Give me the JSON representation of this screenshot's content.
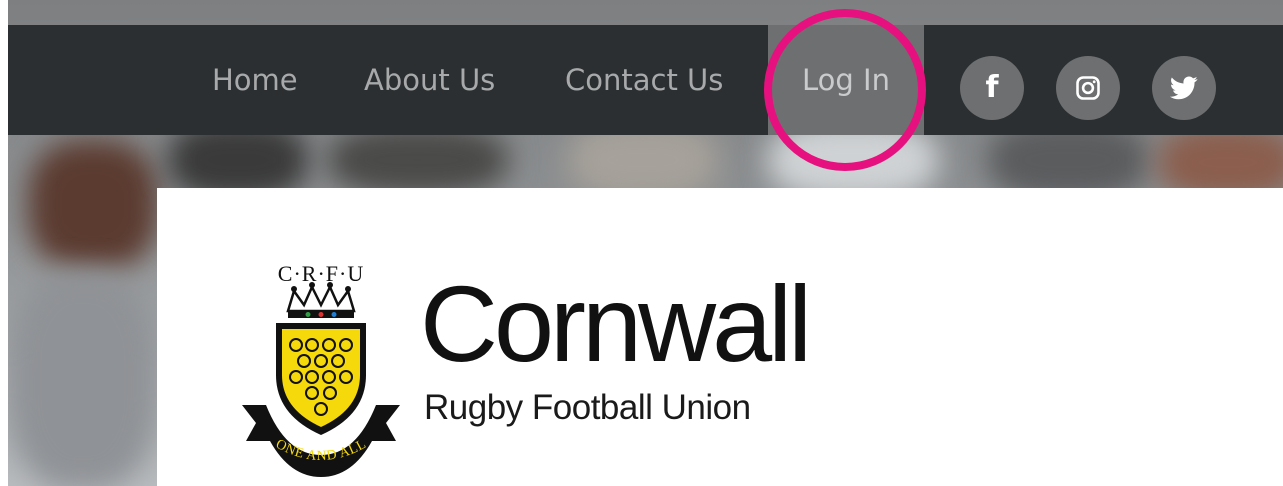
{
  "nav": {
    "items": [
      {
        "label": "Home"
      },
      {
        "label": "About Us"
      },
      {
        "label": "Contact Us"
      },
      {
        "label": "Log In"
      }
    ],
    "social": [
      "facebook-icon",
      "instagram-icon",
      "twitter-icon"
    ],
    "bar_color": "#2c2f31",
    "active_bg": "#6d6f71",
    "highlight_color": "#e6117f"
  },
  "logo": {
    "initials": "C·R·F·U",
    "motto": "ONE AND ALL",
    "name": "Cornwall",
    "subtitle": "Rugby Football Union"
  }
}
